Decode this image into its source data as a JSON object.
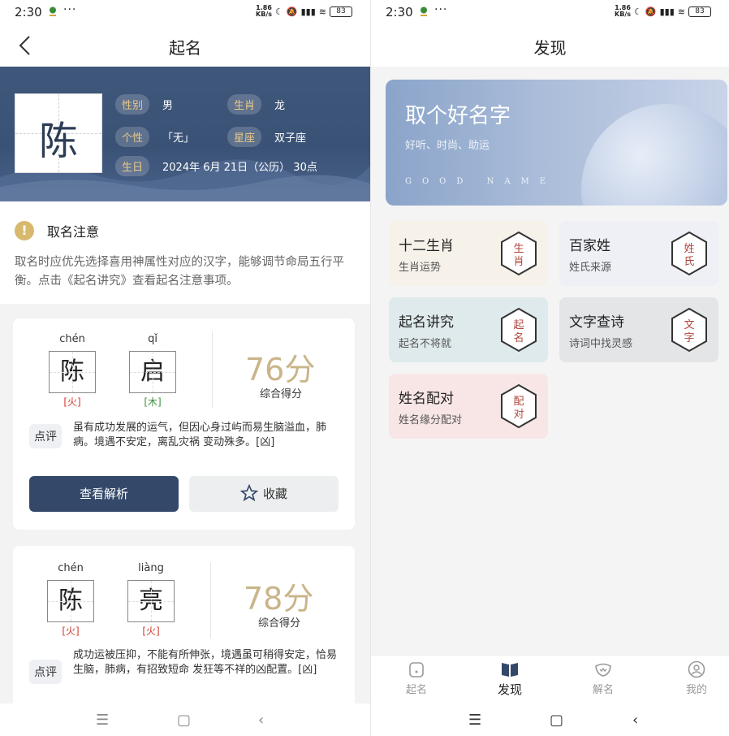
{
  "status": {
    "time": "2:30",
    "dots": "···",
    "speed_value": "1.86",
    "speed_unit": "KB/s",
    "battery": "83"
  },
  "left": {
    "title": "起名",
    "profile": {
      "surname": "陈",
      "gender_label": "性别",
      "gender": "男",
      "zodiac_label": "生肖",
      "zodiac": "龙",
      "personality_label": "个性",
      "personality": "「无」",
      "constellation_label": "星座",
      "constellation": "双子座",
      "birthday_label": "生日",
      "birthday": "2024年 6月 21日（公历） 30点"
    },
    "notice": {
      "icon": "!",
      "title": "取名注意",
      "text": "取名时应优先选择喜用神属性对应的汉字，能够调节命局五行平衡。点击《起名讲究》查看起名注意事项。"
    },
    "names": [
      {
        "chars": [
          {
            "pinyin": "chén",
            "char": "陈",
            "wuxing": "[火]",
            "color": "#d0392b"
          },
          {
            "pinyin": "qǐ",
            "char": "启",
            "wuxing": "[木]",
            "color": "#3f8f3f"
          }
        ],
        "score": "76分",
        "score_label": "综合得分",
        "review_label": "点评",
        "review": "虽有成功发展的运气，但因心身过屿而易生脑溢血，肺病。境遇不安定，离乱灾祸 变动殊多。[凶]",
        "btn_view": "查看解析",
        "btn_fav": "收藏"
      },
      {
        "chars": [
          {
            "pinyin": "chén",
            "char": "陈",
            "wuxing": "[火]",
            "color": "#d0392b"
          },
          {
            "pinyin": "liàng",
            "char": "亮",
            "wuxing": "[火]",
            "color": "#d0392b"
          }
        ],
        "score": "78分",
        "score_label": "综合得分",
        "review_label": "点评",
        "review": "成功运被压抑，不能有所伸张，境遇虽可稍得安定，恰易生脑，肺病，有招致短命 发狂等不祥的凶配置。[凶]"
      }
    ]
  },
  "right": {
    "title": "发现",
    "hero": {
      "title": "取个好名字",
      "subtitle": "好听、时尚、助运",
      "en": "GOOD NAME"
    },
    "features": [
      {
        "title": "十二生肖",
        "subtitle": "生肖运势",
        "bg": "#f6f2ea",
        "seal_text": "生肖"
      },
      {
        "title": "百家姓",
        "subtitle": "姓氏来源",
        "bg": "#eef0f6",
        "seal_text": "姓氏"
      },
      {
        "title": "起名讲究",
        "subtitle": "起名不将就",
        "bg": "#dfeaec",
        "seal_text": "起名"
      },
      {
        "title": "文字查诗",
        "subtitle": "诗词中找灵感",
        "bg": "#e4e5e7",
        "seal_text": "文字"
      },
      {
        "title": "姓名配对",
        "subtitle": "姓名缘分配对",
        "bg": "#f8e6e6",
        "seal_text": "配对"
      }
    ],
    "tabs": [
      {
        "label": "起名",
        "icon": "name-tab-icon"
      },
      {
        "label": "发现",
        "icon": "book-icon"
      },
      {
        "label": "解名",
        "icon": "mask-icon"
      },
      {
        "label": "我的",
        "icon": "user-icon"
      }
    ]
  },
  "colors": {
    "navy": "#34496a",
    "gold": "#c9b58a",
    "tag_gold": "#e9c98a"
  }
}
